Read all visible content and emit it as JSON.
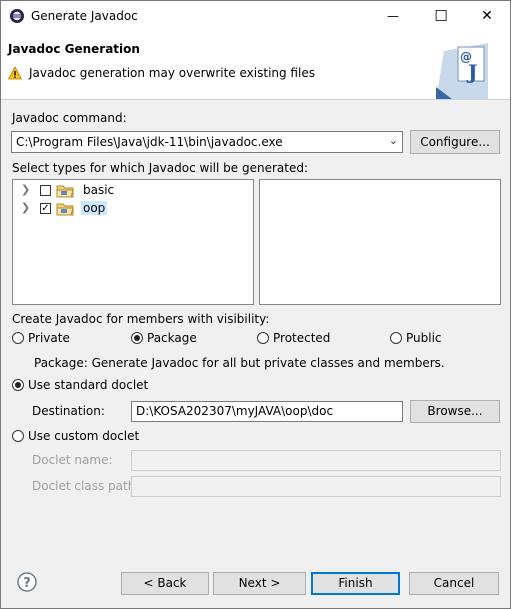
{
  "window": {
    "title": "Generate Javadoc",
    "minimize_glyph": "—",
    "maximize_glyph": "☐",
    "close_glyph": "✕"
  },
  "header": {
    "title": "Javadoc Generation",
    "message": "Javadoc generation may overwrite existing files",
    "icon": "warning-icon",
    "banner_icon": "javadoc-wizard-icon"
  },
  "command": {
    "label": "Javadoc command:",
    "value": "C:\\Program Files\\Java\\jdk-11\\bin\\javadoc.exe",
    "configure_label": "Configure..."
  },
  "types": {
    "label": "Select types for which Javadoc will be generated:",
    "items": [
      {
        "name": "basic",
        "checked": false,
        "selected": false
      },
      {
        "name": "oop",
        "checked": true,
        "selected": true
      }
    ]
  },
  "visibility": {
    "label": "Create Javadoc for members with visibility:",
    "options": [
      "Private",
      "Package",
      "Protected",
      "Public"
    ],
    "selected": "Package",
    "description": "Package: Generate Javadoc for all but private classes and members."
  },
  "standard_doclet": {
    "label": "Use standard doclet",
    "selected": true,
    "destination_label": "Destination:",
    "destination_value": "D:\\KOSA202307\\myJAVA\\oop\\doc",
    "browse_label": "Browse..."
  },
  "custom_doclet": {
    "label": "Use custom doclet",
    "selected": false,
    "name_label": "Doclet name:",
    "name_value": "",
    "classpath_label": "Doclet class path:",
    "classpath_value": ""
  },
  "footer": {
    "back_label": "< Back",
    "next_label": "Next >",
    "finish_label": "Finish",
    "cancel_label": "Cancel",
    "help_icon": "help-icon"
  }
}
